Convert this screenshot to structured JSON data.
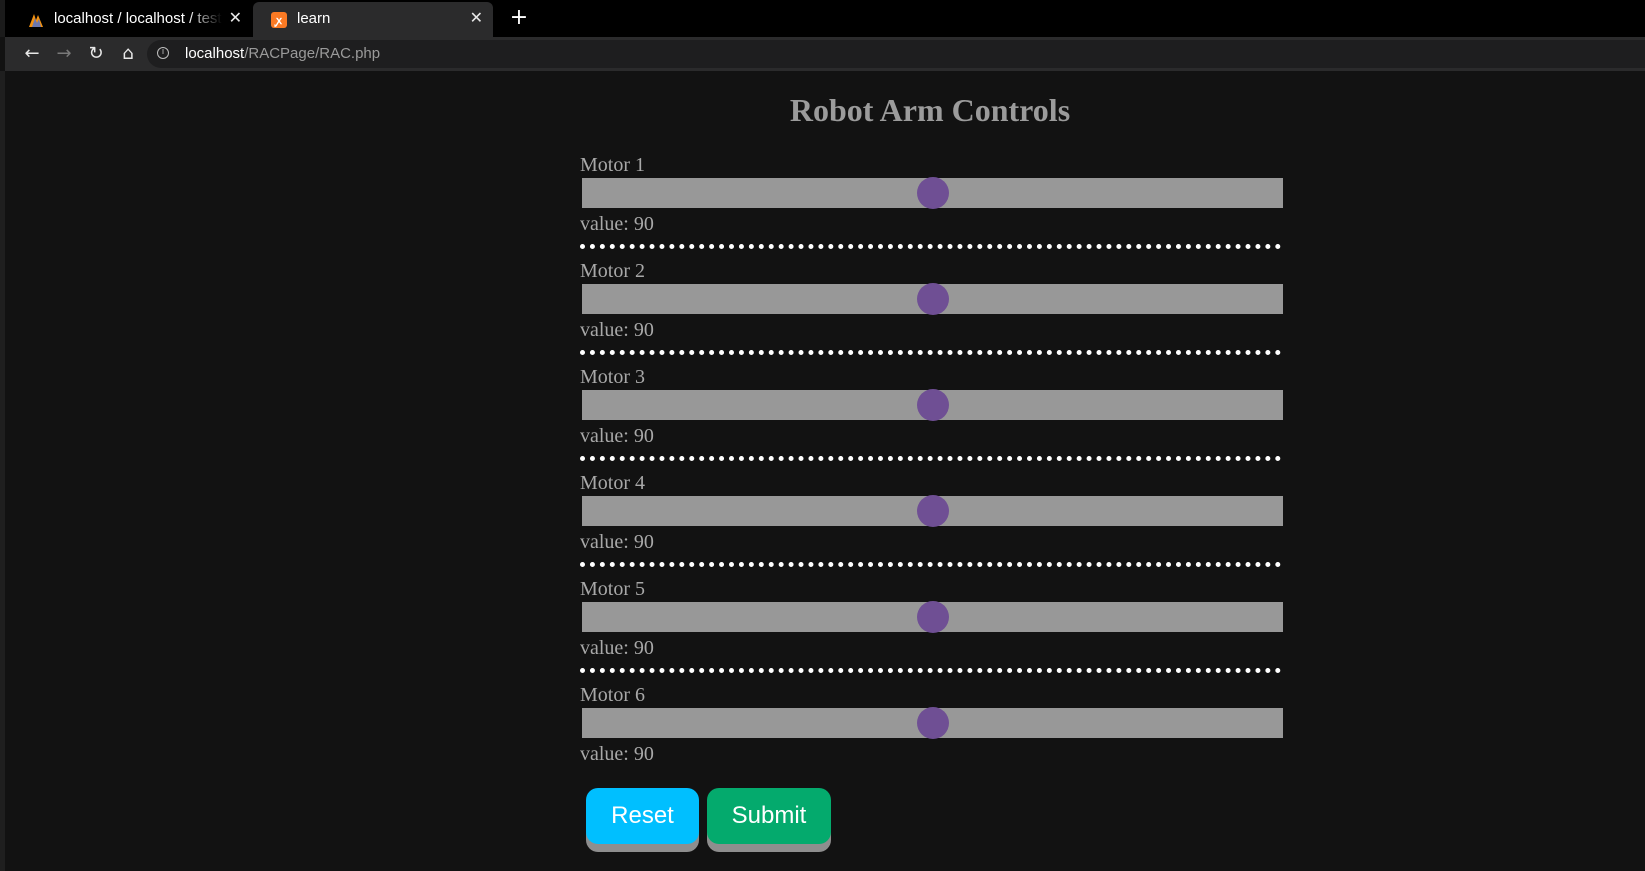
{
  "browser": {
    "tabs": [
      {
        "title": "localhost / localhost / test",
        "favicon": "phpmyadmin-icon",
        "close": "✕"
      },
      {
        "title": "learn",
        "favicon": "xampp-icon",
        "close": "✕"
      }
    ],
    "new_tab": "+",
    "url_host": "localhost",
    "url_path": "/RACPage/RAC.php"
  },
  "page": {
    "title": "Robot Arm Controls",
    "accent_thumb": "#6f4f94",
    "motors": [
      {
        "label": "Motor 1",
        "value_text": "value: 90",
        "value": 90
      },
      {
        "label": "Motor 2",
        "value_text": "value: 90",
        "value": 90
      },
      {
        "label": "Motor 3",
        "value_text": "value: 90",
        "value": 90
      },
      {
        "label": "Motor 4",
        "value_text": "value: 90",
        "value": 90
      },
      {
        "label": "Motor 5",
        "value_text": "value: 90",
        "value": 90
      },
      {
        "label": "Motor 6",
        "value_text": "value: 90",
        "value": 90
      }
    ],
    "slider_range": [
      0,
      180
    ],
    "buttons": {
      "reset": {
        "label": "Reset",
        "color": "#00bfff"
      },
      "submit": {
        "label": "Submit",
        "color": "#04aa6d"
      }
    }
  }
}
